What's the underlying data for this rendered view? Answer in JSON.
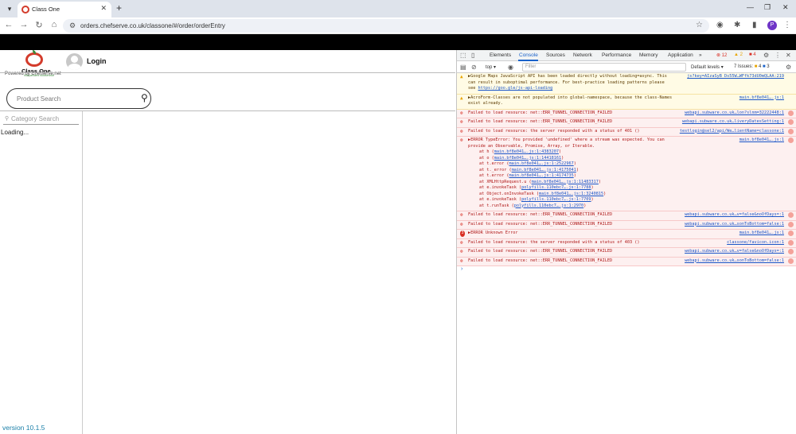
{
  "browser": {
    "tab_title": "Class One",
    "url": "orders.chefserve.co.uk/classone/#/order/orderEntry",
    "profile_initial": "P"
  },
  "page": {
    "logo_text": "Class One",
    "logo_tagline": "independent foodservice",
    "powered_by": "Powered by Chefserve.net",
    "login": "Login",
    "product_search_placeholder": "Product Search",
    "category_search_placeholder": "Category Search",
    "loading": "Loading...",
    "version": "version 10.1.5",
    "accent_color": "#1a7fa8",
    "logo_color": "#d33b2b"
  },
  "devtools": {
    "tabs": [
      "Elements",
      "Console",
      "Sources",
      "Network",
      "Performance",
      "Memory",
      "Application"
    ],
    "active_tab": "Console",
    "more": "»",
    "error_count": "12",
    "warning_count": "2",
    "info_count": "4",
    "context": "top",
    "filter_placeholder": "Filter",
    "levels": "Default levels",
    "issues_label": "7 Issues:",
    "issues_a": "4",
    "issues_b": "3",
    "messages": [
      {
        "level": "warn",
        "text": "▶Google Maps JavaScript API has been loaded directly without loading=async. This can result in suboptimal performance. For best-practice loading patterns please see ",
        "link": "https://goo.gle/js-api-loading",
        "source": "js?key=AIzaSyB_Ds55W…WFfk73dU0mQLAA:219"
      },
      {
        "level": "warn",
        "text": "▶AcroForm-Classes are not populated into global-namespace, because the class-Names exist already.",
        "link": "",
        "source": "main.bf8e041….js:1"
      },
      {
        "level": "err",
        "text": "Failed to load resource: net::ERR_TUNNEL_CONNECTION_FAILED",
        "link": "",
        "source": "webapi.subware.co.uk…lon?slnm=32222448:1"
      },
      {
        "level": "err",
        "text": "Failed to load resource: net::ERR_TUNNEL_CONNECTION_FAILED",
        "link": "",
        "source": "webapi.subware.co.uk…liveryDatesSetting:1"
      },
      {
        "level": "err",
        "text": "Failed to load resource: the server responded with a status of 401 ()",
        "link": "",
        "source": "testlogin@sel2/api/We…lientName=classone:1"
      },
      {
        "level": "err",
        "text": "▶ERROR TypeError: You provided 'undefined' where a stream was expected. You can provide an Observable, Promise, Array, or Iterable.",
        "link": "",
        "source": "main.bf8e041….js:1",
        "stack": [
          {
            "fn": "at h (",
            "loc": "main.bf8e041….js:1:4383207",
            "end": ")"
          },
          {
            "fn": "at o (",
            "loc": "main.bf8e041….js:1:14418161",
            "end": ")"
          },
          {
            "fn": "at t.error (",
            "loc": "main.bf8e041….js:1:2522967",
            "end": ")"
          },
          {
            "fn": "at t._error (",
            "loc": "main.bf8e041….js:1:4175041",
            "end": ")"
          },
          {
            "fn": "at t.error (",
            "loc": "main.bf8e041….js:1:4174735",
            "end": ")"
          },
          {
            "fn": "at XMLHttpRequest.u (",
            "loc": "main.bf8e041….js:1:11483317",
            "end": ")"
          },
          {
            "fn": "at e.invokeTask (",
            "loc": "polyfills.110ebc7….js:1:7788",
            "end": ")"
          },
          {
            "fn": "at Object.onInvokeTask (",
            "loc": "main.bf8e041….js:1:3240815",
            "end": ")"
          },
          {
            "fn": "at e.invokeTask (",
            "loc": "polyfills.110ebc7….js:1:7709",
            "end": ")"
          },
          {
            "fn": "at t.runTask (",
            "loc": "polyfills.110ebc7….js:1:2970",
            "end": ")"
          }
        ]
      },
      {
        "level": "err",
        "text": "Failed to load resource: net::ERR_TUNNEL_CONNECTION_FAILED",
        "link": "",
        "source": "webapi.subware.co.uk…v=false&noOfDays=:1"
      },
      {
        "level": "err",
        "text": "Failed to load resource: net::ERR_TUNNEL_CONNECTION_FAILED",
        "link": "",
        "source": "webapi.subware.co.uk…sonToBottom=false:1"
      },
      {
        "level": "err",
        "text": "▶ERROR Unknown Error",
        "link": "",
        "source": "main.bf8e041….js:1",
        "count": "3"
      },
      {
        "level": "err",
        "text": "Failed to load resource: the server responded with a status of 403 ()",
        "link": "",
        "source": "classone/favicon.icon:1"
      },
      {
        "level": "err",
        "text": "Failed to load resource: net::ERR_TUNNEL_CONNECTION_FAILED",
        "link": "",
        "source": "webapi.subware.co.uk…v=false&noOfDays=:1"
      },
      {
        "level": "err",
        "text": "Failed to load resource: net::ERR_TUNNEL_CONNECTION_FAILED",
        "link": "",
        "source": "webapi.subware.co.uk…sonToBottom=false:1"
      }
    ],
    "prompt": "›"
  }
}
